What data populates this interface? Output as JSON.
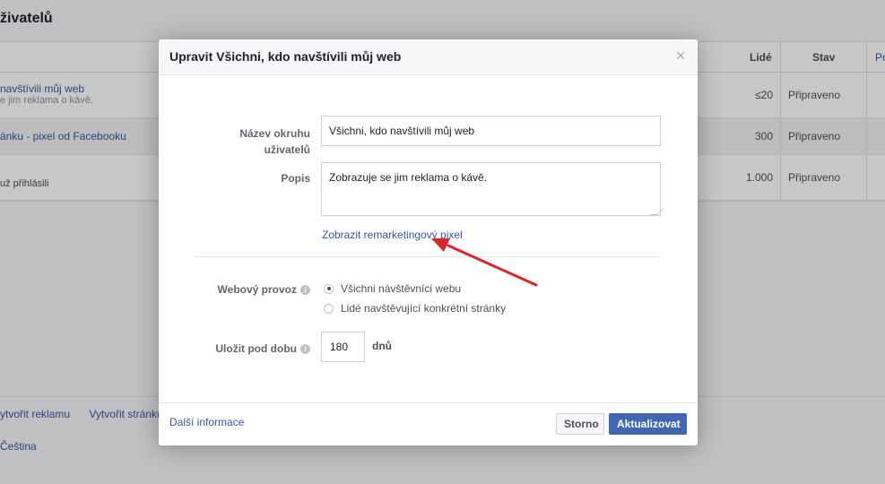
{
  "background": {
    "page_title": "živatelů",
    "table": {
      "headers": {
        "people": "Lidé",
        "status": "Stav",
        "extra": "Po"
      },
      "rows": [
        {
          "name": "navštívili můj web",
          "sub": "e jim reklama o kávě.",
          "count": "≤20",
          "status": "Připraveno"
        },
        {
          "name": "ánku - pixel od Facebooku",
          "sub": "",
          "count": "300",
          "status": "Připraveno"
        },
        {
          "name": "",
          "sub": "už přihlásili",
          "count": "1.000",
          "status": "Připraveno"
        }
      ]
    },
    "footer_links": [
      "ytvořit reklamu",
      "Vytvořit stránku"
    ],
    "language": "Čeština"
  },
  "dialog": {
    "title": "Upravit Všichni, kdo navštívili můj web",
    "close_symbol": "×",
    "audience_name_label": "Název okruhu uživatelů",
    "audience_name_value": "Všichni, kdo navštívili můj web",
    "description_label": "Popis",
    "description_value": "Zobrazuje se jim reklama o kávě.",
    "pixel_link": "Zobrazit remarketingový pixel",
    "web_traffic_label": "Webový provoz",
    "traffic_options": [
      {
        "label": "Všichni návštěvníci webu",
        "selected": true
      },
      {
        "label": "Lidé navštěvující konkrétní stránky",
        "selected": false
      }
    ],
    "retention_label": "Uložit pod dobu",
    "retention_value": "180",
    "retention_unit": "dnů",
    "more_info": "Další informace",
    "cancel_label": "Storno",
    "update_label": "Aktualizovat",
    "info_symbol": "i"
  },
  "colors": {
    "accent": "#4267b2",
    "link": "#365899",
    "annotation": "#d9262a"
  }
}
